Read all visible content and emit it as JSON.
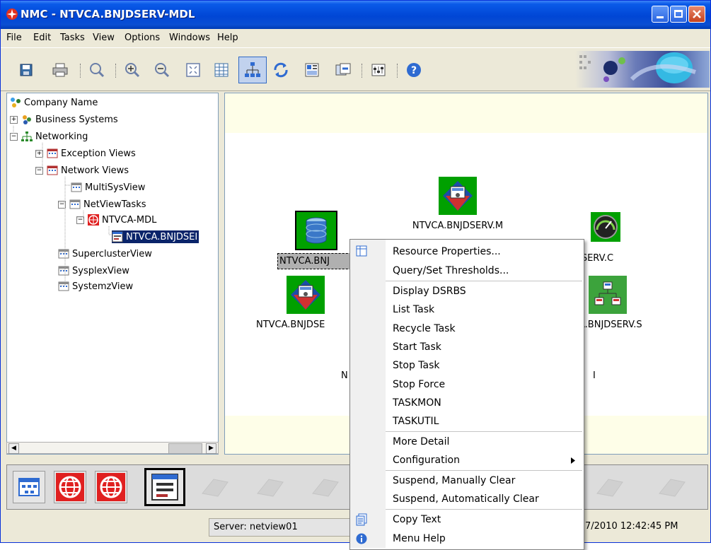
{
  "window": {
    "title": "NMC - NTVCA.BNJDSERV-MDL"
  },
  "menubar": [
    "File",
    "Edit",
    "Tasks",
    "View",
    "Options",
    "Windows",
    "Help"
  ],
  "toolbar": {
    "tools": [
      "save-icon",
      "print-icon",
      "find-icon",
      "zoom-in-icon",
      "zoom-out-icon",
      "fit-icon",
      "table-view-icon",
      "topology-view-icon",
      "refresh-icon",
      "panel-icon",
      "sync-icon",
      "filter-icon",
      "help-icon"
    ]
  },
  "tree": {
    "nodes": [
      {
        "label": "Company Name"
      },
      {
        "label": "Business Systems"
      },
      {
        "label": "Networking"
      },
      {
        "label": "Exception Views"
      },
      {
        "label": "Network Views"
      },
      {
        "label": "MultiSysView"
      },
      {
        "label": "NetViewTasks"
      },
      {
        "label": "NTVCA-MDL"
      },
      {
        "label": "NTVCA.BNJDSEI"
      },
      {
        "label": "SuperclusterView"
      },
      {
        "label": "SysplexView"
      },
      {
        "label": "SystemzView"
      }
    ]
  },
  "resources": {
    "top": "NTVCA.BNJDSERV.M",
    "selected": "NTVCA.BNJ",
    "right1": "JDSERV.C",
    "left2": "NTVCA.BNJDSE",
    "right2": "A.BNJDSERV.S",
    "partial_left": "N",
    "partial_right": "I"
  },
  "context_menu": {
    "items": [
      "Resource Properties...",
      "Query/Set Thresholds...",
      "Display DSRBS",
      "List Task",
      "Recycle Task",
      "Start Task",
      "Stop Task",
      "Stop Force",
      "TASKMON",
      "TASKUTIL",
      "More Detail",
      "Configuration",
      "Suspend, Manually Clear",
      "Suspend, Automatically Clear",
      "Copy Text",
      "Menu Help"
    ]
  },
  "status": {
    "server": "Server: netview01",
    "datetime": "7/2010 12:42:45 PM"
  },
  "colors": {
    "title_blue": "#0046d5",
    "node_green": "#00a000",
    "yellow_band": "#fefee8"
  }
}
